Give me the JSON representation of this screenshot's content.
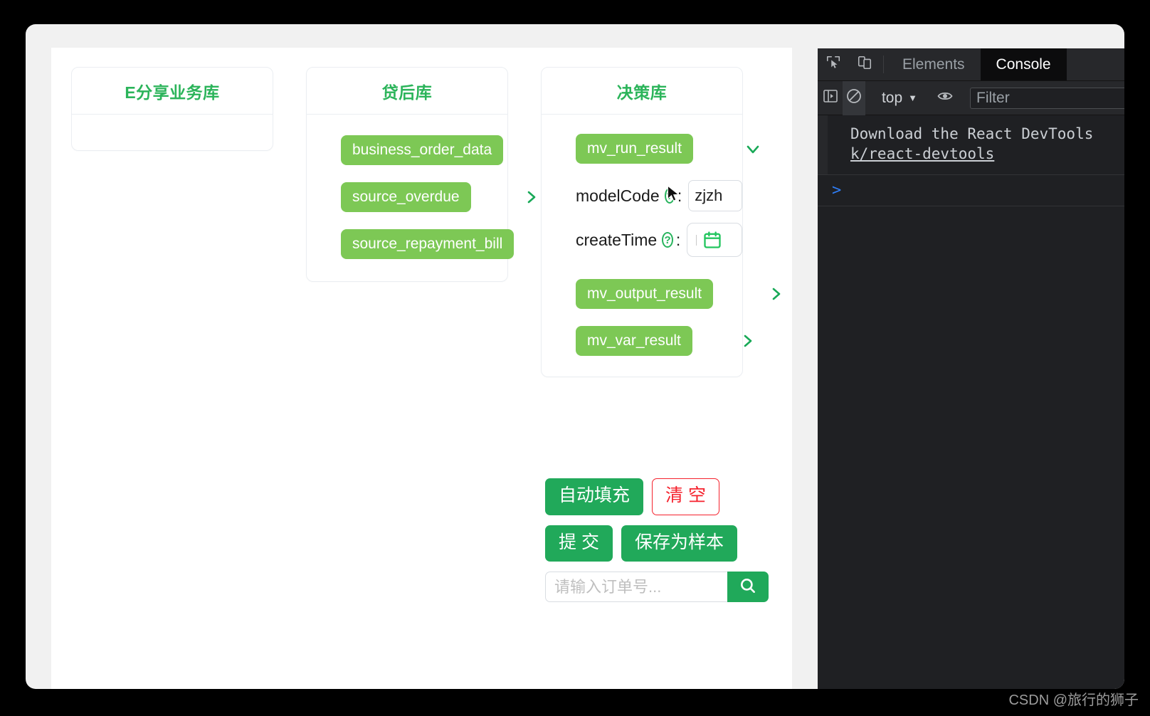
{
  "window": {
    "background_color": "#000000",
    "chrome_color": "#f1f1f1"
  },
  "page": {
    "cards": [
      {
        "title": "E分享业务库",
        "tags": []
      },
      {
        "title": "贷后库",
        "tags": [
          "business_order_data",
          "source_overdue",
          "source_repayment_bill"
        ]
      },
      {
        "title": "决策库",
        "tags": [
          "mv_run_result",
          "mv_output_result",
          "mv_var_result"
        ],
        "fields": [
          {
            "label": "modelCode",
            "help": "?",
            "value": "zjzh"
          },
          {
            "label": "createTime",
            "help": "?",
            "value": ""
          }
        ]
      }
    ],
    "icons": {
      "chevron_right": "chevron-right-icon",
      "chevron_down": "chevron-down-icon",
      "calendar": "calendar-icon",
      "search": "search-icon",
      "help": "help-circle-icon"
    },
    "buttons": {
      "auto_fill": "自动填充",
      "clear": "清 空",
      "submit": "提 交",
      "save_as_sample": "保存为样本"
    },
    "search": {
      "placeholder": "请输入订单号...",
      "value": ""
    },
    "colors": {
      "tag_green": "#7dc855",
      "button_green": "#21a95a",
      "title_green": "#2bb45a",
      "danger_red": "#f5222d"
    }
  },
  "devtools": {
    "tabs": [
      {
        "label": "Elements",
        "active": false
      },
      {
        "label": "Console",
        "active": true
      }
    ],
    "toolbar": {
      "context": "top",
      "filter_placeholder": "Filter",
      "filter_value": ""
    },
    "console": {
      "messages": [
        {
          "text": "Download the React DevTools",
          "link": "k/react-devtools"
        }
      ],
      "prompt": ">"
    }
  },
  "watermark": "CSDN @旅行的狮子"
}
